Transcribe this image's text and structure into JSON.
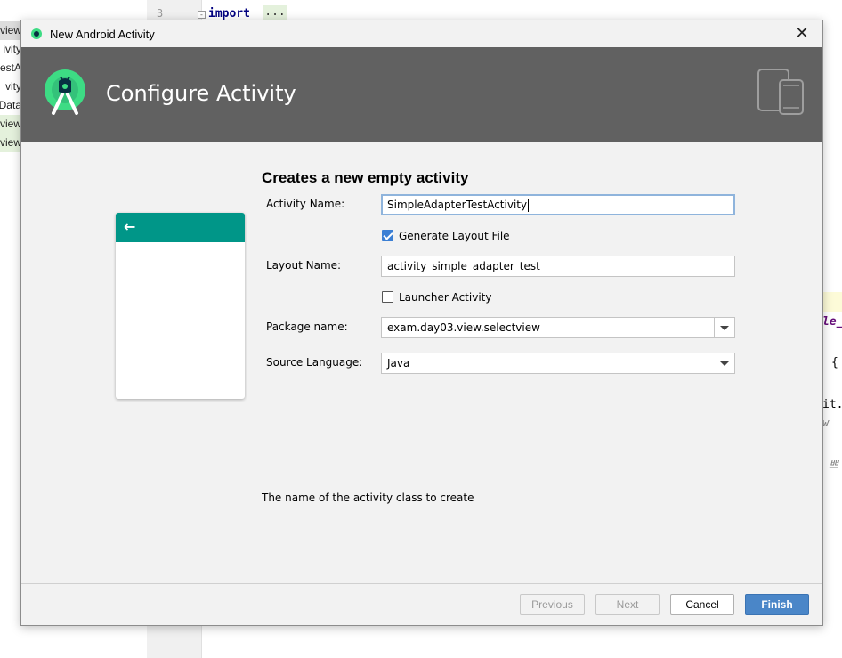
{
  "ide": {
    "left_items": [
      "view",
      "ivity",
      "estA",
      "vity",
      "Data",
      "view",
      "view"
    ],
    "line_number": "3",
    "fold_glyph": "-",
    "code_keyword": "import",
    "code_ellipsis": "...",
    "right_fragments": [
      "le_",
      "{",
      "it.",
      "w",
      "쁘"
    ]
  },
  "dialog": {
    "title": "New Android Activity",
    "close_glyph": "✕",
    "header_title": "Configure Activity",
    "section_title": "Creates a new empty activity",
    "preview": {
      "back_glyph": "←",
      "bar_color": "#009688"
    },
    "fields": {
      "activity_name": {
        "label": "Activity Name:",
        "value": "SimpleAdapterTestActivity"
      },
      "generate_layout": {
        "label": "Generate Layout File",
        "checked": true
      },
      "layout_name": {
        "label": "Layout Name:",
        "value": "activity_simple_adapter_test"
      },
      "launcher_activity": {
        "label": "Launcher Activity",
        "checked": false
      },
      "package_name": {
        "label": "Package name:",
        "value": "exam.day03.view.selectview"
      },
      "source_language": {
        "label": "Source Language:",
        "value": "Java"
      }
    },
    "help_text": "The name of the activity class to create",
    "buttons": {
      "previous": "Previous",
      "next": "Next",
      "cancel": "Cancel",
      "finish": "Finish"
    },
    "colors": {
      "header_bg": "#616161",
      "primary_button": "#4a86c8",
      "checkbox": "#3b7fd4",
      "android_green": "#3ddc84"
    }
  }
}
